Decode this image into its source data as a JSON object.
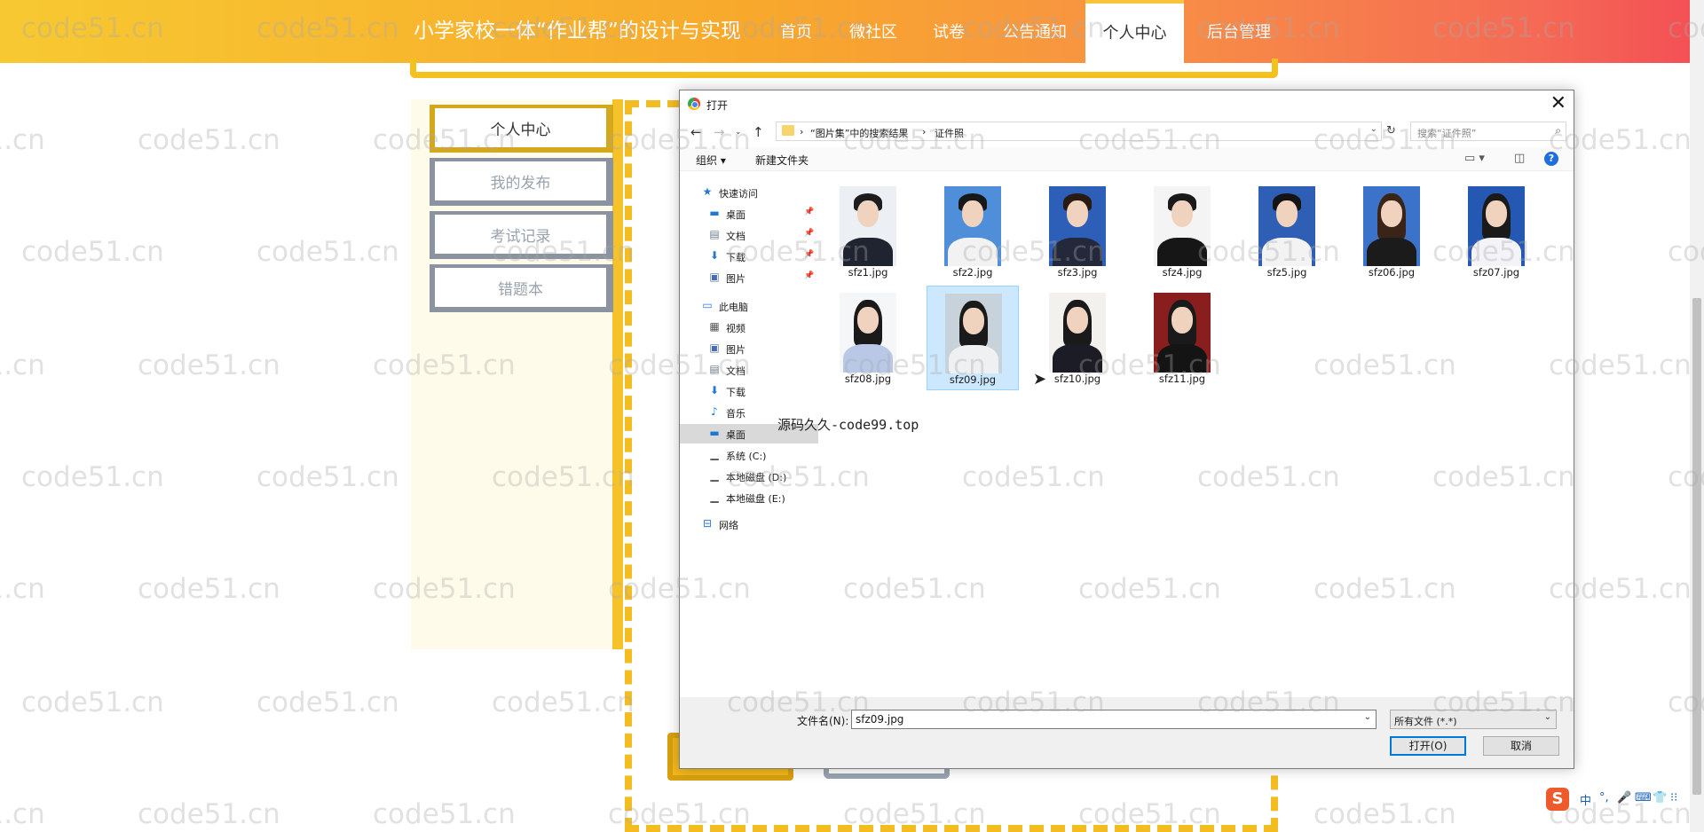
{
  "site": {
    "title": "小学家校一体“作业帮”的设计与实现",
    "nav": [
      {
        "label": "首页"
      },
      {
        "label": "微社区"
      },
      {
        "label": "试卷"
      },
      {
        "label": "公告通知"
      },
      {
        "label": "个人中心",
        "active": true
      },
      {
        "label": "后台管理"
      }
    ],
    "sidebar": [
      "个人中心",
      "我的发布",
      "考试记录",
      "错题本"
    ],
    "accent": "#f5c11e",
    "watermark": "code51.cn"
  },
  "dialog": {
    "title": "打开",
    "close_icon": "close-icon",
    "breadcrumb": [
      "“图片集”中的搜索结果",
      "证件照"
    ],
    "search_placeholder": "搜索“证件照”",
    "toolbar": {
      "organize": "组织 ▾",
      "new_folder": "新建文件夹"
    },
    "nav_groups": [
      {
        "label": "快速访问",
        "icon": "star-icon",
        "children": [
          {
            "label": "桌面",
            "icon": "desktop-icon",
            "pinned": true
          },
          {
            "label": "文档",
            "icon": "document-icon",
            "pinned": true
          },
          {
            "label": "下载",
            "icon": "download-icon",
            "pinned": true
          },
          {
            "label": "图片",
            "icon": "picture-icon",
            "pinned": true
          }
        ]
      },
      {
        "label": "此电脑",
        "icon": "computer-icon",
        "children": [
          {
            "label": "视频",
            "icon": "video-icon"
          },
          {
            "label": "图片",
            "icon": "picture-icon"
          },
          {
            "label": "文档",
            "icon": "document-icon"
          },
          {
            "label": "下载",
            "icon": "download-icon"
          },
          {
            "label": "音乐",
            "icon": "music-icon"
          },
          {
            "label": "桌面",
            "icon": "desktop-icon",
            "selected": true
          },
          {
            "label": "系统 (C:)",
            "icon": "drive-icon"
          },
          {
            "label": "本地磁盘 (D:)",
            "icon": "drive-icon"
          },
          {
            "label": "本地磁盘 (E:)",
            "icon": "drive-icon"
          }
        ]
      },
      {
        "label": "网络",
        "icon": "network-icon",
        "children": []
      }
    ],
    "files": [
      {
        "name": "sfz1.jpg",
        "bg": "#eceff3",
        "hair": "#1d1d1d",
        "long": false,
        "body": "#1f2430"
      },
      {
        "name": "sfz2.jpg",
        "bg": "#4f8ed8",
        "hair": "#181818",
        "long": false,
        "body": "#f2f2f2"
      },
      {
        "name": "sfz3.jpg",
        "bg": "#2e5fb8",
        "hair": "#2a1b12",
        "long": false,
        "body": "#23283a"
      },
      {
        "name": "sfz4.jpg",
        "bg": "#f4f4f4",
        "hair": "#1a1a1a",
        "long": false,
        "body": "#161616"
      },
      {
        "name": "sfz5.jpg",
        "bg": "#2f5eb5",
        "hair": "#141414",
        "long": false,
        "body": "#f3f3f3"
      },
      {
        "name": "sfz06.jpg",
        "bg": "#3a73c9",
        "hair": "#3a2418",
        "long": true,
        "body": "#1b1b1b"
      },
      {
        "name": "sfz07.jpg",
        "bg": "#2458b3",
        "hair": "#1a1a1a",
        "long": true,
        "body": "#f4f4f8"
      },
      {
        "name": "sfz08.jpg",
        "bg": "#f5f6f8",
        "hair": "#1a1a1a",
        "long": true,
        "body": "#b9c8e6"
      },
      {
        "name": "sfz09.jpg",
        "bg": "#c8d2da",
        "hair": "#1a1a1a",
        "long": true,
        "body": "#eef0f2",
        "selected": true
      },
      {
        "name": "sfz10.jpg",
        "bg": "#f2f1ee",
        "hair": "#1a1a1a",
        "long": true,
        "body": "#1c1c26"
      },
      {
        "name": "sfz11.jpg",
        "bg": "#8a1d1d",
        "hair": "#1a1a1a",
        "long": true,
        "body": "#141414"
      }
    ],
    "overlay_text": "源码久久-code99.top",
    "filename_label": "文件名(N):",
    "filename_value": "sfz09.jpg",
    "filetype": "所有文件 (*.*)",
    "open_label": "打开(O)",
    "cancel_label": "取消"
  },
  "ime": {
    "logo": "S",
    "items": [
      "中",
      "°,",
      "🎤",
      "⌨",
      "👕",
      "⁝⁝"
    ]
  }
}
